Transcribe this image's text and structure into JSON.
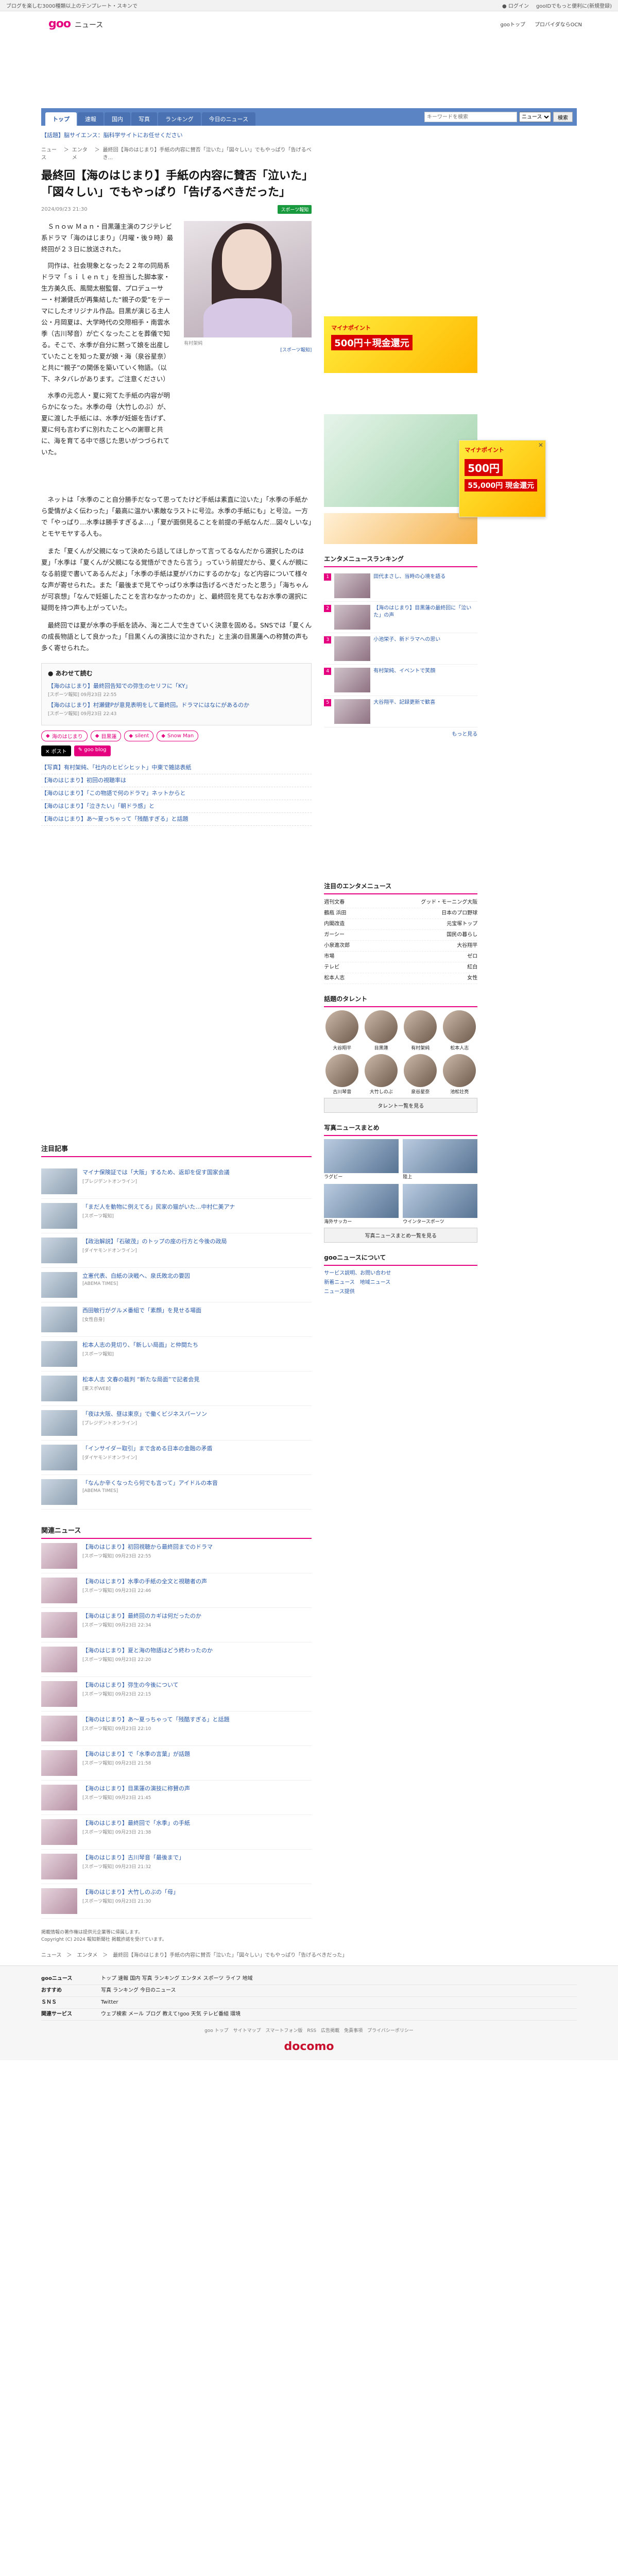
{
  "topbar": {
    "left": "ブログを楽しむ3000種類以上のテンプレート・スキンで",
    "login": "ログイン",
    "right": "gooIDでもっと便利に(新規登録)"
  },
  "header": {
    "logo": "goo",
    "sub": "ニュース",
    "link1": "gooトップ",
    "link2": "プロバイダならOCN"
  },
  "nav": {
    "tabs": [
      "トップ",
      "速報",
      "国内",
      "写真",
      "ランキング",
      "今日のニュース"
    ],
    "search_placeholder": "キーワードを検索",
    "search_select": "ニュース",
    "search_btn": "検索"
  },
  "notice": "【話題】脳サイエンス：脳科学サイトにお任せください",
  "crumb": [
    "ニュース",
    "エンタメ",
    "最終回【海のはじまり】手紙の内容に賛否「泣いた」「図々しい」でもやっぱり「告げるべき..."
  ],
  "article": {
    "title": "最終回【海のはじまり】手紙の内容に賛否「泣いた」「図々しい」でもやっぱり「告げるべきだった」",
    "date": "2024/09/23 21:30",
    "source_badge": "スポーツ報知",
    "lead": [
      "Ｓｎｏｗ Ｍａｎ・目黒蓮主演のフジテレビ系ドラマ「海のはじまり」（月曜・後９時）最終回が２３日に放送された。",
      "同作は、社会現象となった２２年の同局系ドラマ「ｓｉｌｅｎｔ」を担当した脚本家・生方美久氏、風間太樹監督、プロデューサー・村瀬健氏が再集結した“親子の愛”をテーマにしたオリジナル作品。目黒が演じる主人公・月岡夏は、大学時代の交際相手・南雲水季（古川琴音）が亡くなったことを葬儀で知る。そこで、水季が自分に黙って娘を出産していたことを知った夏が娘・海（泉谷星奈）と共に“親子”の関係を築いていく物語。（以下、ネタバレがあります。ご注意ください）"
    ],
    "lead_tail": "水季の元恋人・夏に宛てた手紙の内容が明らかになった。水季の母（大竹しのぶ）が、夏に渡した手紙には、水季が妊娠を告げず、夏に何も言わずに別れたことへの謝罪と共に、海を育てる中で感じた思いがつづられていた。",
    "photo_cap": "有村架純",
    "photo_more": "[スポーツ報知]",
    "body": [
      "ネットは「水季のこと自分勝手だなって思ってたけど手紙は素直に泣いた」「水季の手紙から愛情がよく伝わった」「最高に温かい素敵なラストに号泣。水季の手紙にも」と号泣。一方で「やっぱり…水季は勝手すぎるよ…」「夏が面倒見ることを前提の手紙なんだ…図々しいな」とモヤモヤする人も。",
      "また「夏くんが父親になって決めたら話してほしかって言ってるなんだから選択したのは夏」「水季は「夏くんが父親になる覚悟ができたら言う」っていう前提だから、夏くんが親になる前提で書いてあるんだよ」「水季の手紙は夏がバカにするのかな」など内容について様々な声が寄せられた。また「最後まで見てやっぱり水季は告げるべきだったと思う」「海ちゃんが可哀想」「なんで妊娠したことを言わなかったのか」と、最終回を見てもなお水季の選択に疑問を持つ声も上がっていた。",
      "最終回では夏が水季の手紙を読み、海と二人で生きていく決意を固める。SNSでは「夏くんの成長物語として良かった」「目黒くんの演技に泣かされた」と主演の目黒蓮への称賛の声も多く寄せられた。"
    ],
    "related_h": "あわせて読む",
    "related": [
      {
        "t": "【海のはじまり】最終回告知での弥生のセリフに「KY」",
        "s": "[スポーツ報知] 09月23日 22:55"
      },
      {
        "t": "【海のはじまり】村瀬健Pが意見表明をして最終回。ドラマにはなにがあるのか",
        "s": "[スポーツ報知] 09月23日 22:43"
      }
    ],
    "tags": [
      "海のはじまり",
      "目黒蓮",
      "silent",
      "Snow Man"
    ],
    "share_x": "ポスト",
    "share_g": "goo blog",
    "links": [
      "【写真】有村架純、「社内のヒビシヒット」中東で雑誌表紙",
      "【海のはじまり】初回の視聴率は",
      "【海のはじまり】「この物語で何のドラマ」ネットからと",
      "【海のはじまり】「泣きたい」「朝ドラ感」と",
      "【海のはじまり】あ〜夏っちゃって「残酷すぎる」と話題"
    ]
  },
  "attn": {
    "h": "注目記事",
    "items": [
      {
        "t": "マイナ保険証では「大阪」するため、返却を促す国家会議",
        "s": "[プレジデントオンライン]"
      },
      {
        "t": "「まだ人を動物に例えてる」民家の猫がいた…中村仁美アナ",
        "s": "[スポーツ報知]"
      },
      {
        "t": "【政治解説】「石破茂」のトップの座の行方と今後の政局",
        "s": "[ダイヤモンドオンライン]"
      },
      {
        "t": "立憲代表、白紙の決戦へ、泉氏敗北の要因",
        "s": "[ABEMA TIMES]"
      },
      {
        "t": "西田敏行がグルメ番組で「素顔」を見せる場面",
        "s": "[女性自身]"
      },
      {
        "t": "松本人志の見切り、「新しい局面」と仲間たち",
        "s": "[スポーツ報知]"
      },
      {
        "t": "松本人志 文春の裁判 “新たな局面”で記者会見",
        "s": "[東スポWEB]"
      },
      {
        "t": "「夜は大阪、昼は東京」で働くビジネスパーソン",
        "s": "[プレジデントオンライン]"
      },
      {
        "t": "「インサイダー取引」まで含める日本の金融の矛盾",
        "s": "[ダイヤモンドオンライン]"
      },
      {
        "t": "「なんか辛くなったら何でも言って」アイドルの本音",
        "s": "[ABEMA TIMES]"
      }
    ]
  },
  "rel2": {
    "h": "関連ニュース",
    "items": [
      {
        "t": "【海のはじまり】初回視聴から最終回までのドラマ",
        "s": "[スポーツ報知] 09月23日 22:55"
      },
      {
        "t": "【海のはじまり】水季の手紙の全文と視聴者の声",
        "s": "[スポーツ報知] 09月23日 22:46"
      },
      {
        "t": "【海のはじまり】最終回のカギは何だったのか",
        "s": "[スポーツ報知] 09月23日 22:34"
      },
      {
        "t": "【海のはじまり】夏と海の物語はどう終わったのか",
        "s": "[スポーツ報知] 09月23日 22:20"
      },
      {
        "t": "【海のはじまり】弥生の今後について",
        "s": "[スポーツ報知] 09月23日 22:15"
      },
      {
        "t": "【海のはじまり】あ〜夏っちゃって「残酷すぎる」と話題",
        "s": "[スポーツ報知] 09月23日 22:10"
      },
      {
        "t": "【海のはじまり】で「水季の言葉」が話題",
        "s": "[スポーツ報知] 09月23日 21:58"
      },
      {
        "t": "【海のはじまり】目黒蓮の演技に称賛の声",
        "s": "[スポーツ報知] 09月23日 21:45"
      },
      {
        "t": "【海のはじまり】最終回で「水季」の手紙",
        "s": "[スポーツ報知] 09月23日 21:38"
      },
      {
        "t": "【海のはじまり】古川琴音「最後まで」",
        "s": "[スポーツ報知] 09月23日 21:32"
      },
      {
        "t": "【海のはじまり】大竹しのぶの「母」",
        "s": "[スポーツ報知] 09月23日 21:30"
      }
    ]
  },
  "side": {
    "rank_h": "エンタメニュースランキング",
    "rank": [
      {
        "n": "1",
        "t": "田代まさし、当時の心境を語る"
      },
      {
        "n": "2",
        "t": "【海のはじまり】目黒蓮の最終回に「泣いた」の声"
      },
      {
        "n": "3",
        "t": "小池栄子、新ドラマへの思い"
      },
      {
        "n": "4",
        "t": "有村架純、イベントで笑顔"
      },
      {
        "n": "5",
        "t": "大谷翔平、記録更新で歓喜"
      }
    ],
    "rank_more": "もっと見る",
    "kw_h": "注目のエンタメニュース",
    "kw": [
      {
        "a": "週刊文春",
        "b": "グッド・モーニング大阪"
      },
      {
        "a": "鶴瓶 浜田",
        "b": "日本のプロ野球"
      },
      {
        "a": "内閣改造",
        "b": "元宝塚トップ"
      },
      {
        "a": "ガーシー",
        "b": "国民の暮らし"
      },
      {
        "a": "小泉進次郎",
        "b": "大谷翔平"
      },
      {
        "a": "市場",
        "b": "ゼロ"
      },
      {
        "a": "テレビ",
        "b": "紅白"
      },
      {
        "a": "松本人志",
        "b": "女性"
      }
    ],
    "talent_h": "話題のタレント",
    "talent": [
      "大谷翔平",
      "目黒蓮",
      "有村架純",
      "松本人志",
      "古川琴音",
      "大竹しのぶ",
      "泉谷星奈",
      "池松壮亮"
    ],
    "talent_btn": "タレント一覧を見る",
    "photo_h": "写真ニュースまとめ",
    "photos": [
      "ラグビー",
      "陸上",
      "海外サッカー",
      "ウインタースポーツ"
    ],
    "photo_btn": "写真ニュースまとめ一覧を見る",
    "about_h": "gooニュースについて",
    "about": [
      "サービス説明、お問い合わせ",
      "新着ニュース　地域ニュース",
      "ニュース提供"
    ]
  },
  "copy": [
    "掲載情報の著作権は提供元企業等に帰属します。",
    "Copyright (C) 2024 報知新聞社 掲載許諾を受けています。"
  ],
  "footcrumb": "ニュース　＞　エンタメ　＞　最終回【海のはじまり】手紙の内容に賛否「泣いた」「図々しい」でもやっぱり「告げるべきだった」",
  "footer": {
    "rows": [
      {
        "h": "gooニュース",
        "l": "トップ 速報 国内 写真 ランキング エンタメ スポーツ ライフ 地域"
      },
      {
        "h": "おすすめ",
        "l": "写真 ランキング 今日のニュース"
      },
      {
        "h": "ＳＮＳ",
        "l": "Twitter"
      },
      {
        "h": "関連サービス",
        "l": "ウェブ検索 メール ブログ 教えて!goo 天気 テレビ番組 環境"
      }
    ],
    "bottom": "goo トップ　サイトマップ　スマートフォン版　RSS　広告掲載　免責事項　プライバシーポリシー",
    "docomo": "docomo"
  }
}
